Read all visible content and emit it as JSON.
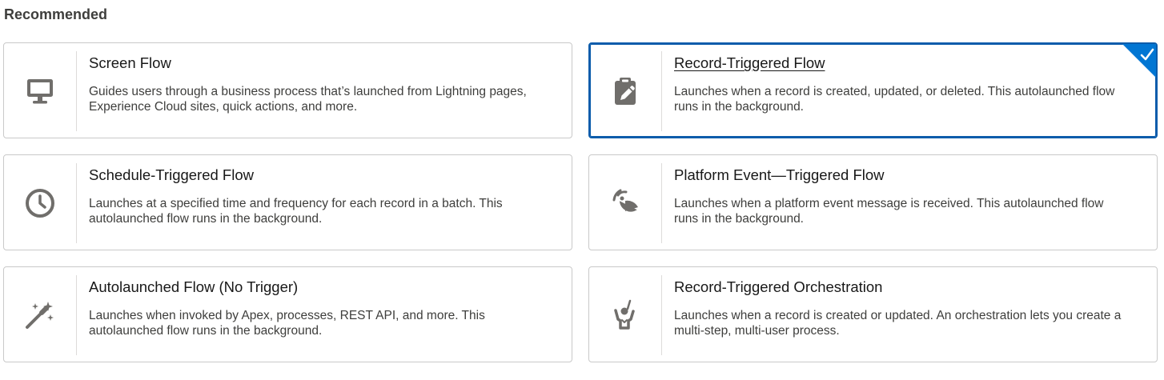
{
  "section": {
    "title": "Recommended"
  },
  "cards": [
    {
      "title": "Screen Flow",
      "description": "Guides users through a business process that’s launched from Lightning pages, Experience Cloud sites, quick actions, and more.",
      "icon": "desktop-icon",
      "selected": false
    },
    {
      "title": "Record-Triggered Flow",
      "description": "Launches when a record is created, updated, or deleted. This autolaunched flow runs in the background.",
      "icon": "clipboard-edit-icon",
      "selected": true
    },
    {
      "title": "Schedule-Triggered Flow",
      "description": "Launches at a specified time and frequency for each record in a batch. This autolaunched flow runs in the background.",
      "icon": "clock-icon",
      "selected": false
    },
    {
      "title": "Platform Event—Triggered Flow",
      "description": "Launches when a platform event message is received. This autolaunched flow runs in the background.",
      "icon": "broadcast-dish-icon",
      "selected": false
    },
    {
      "title": "Autolaunched Flow (No Trigger)",
      "description": "Launches when invoked by Apex, processes, REST API, and more. This autolaunched flow runs in the background.",
      "icon": "magic-wand-icon",
      "selected": false
    },
    {
      "title": "Record-Triggered Orchestration",
      "description": "Launches when a record is created or updated. An orchestration lets you create a multi-step, multi-user process.",
      "icon": "conductor-icon",
      "selected": false
    }
  ],
  "colors": {
    "selected_border": "#0b5cab",
    "check_badge": "#0176d3",
    "icon": "#706e6b"
  }
}
